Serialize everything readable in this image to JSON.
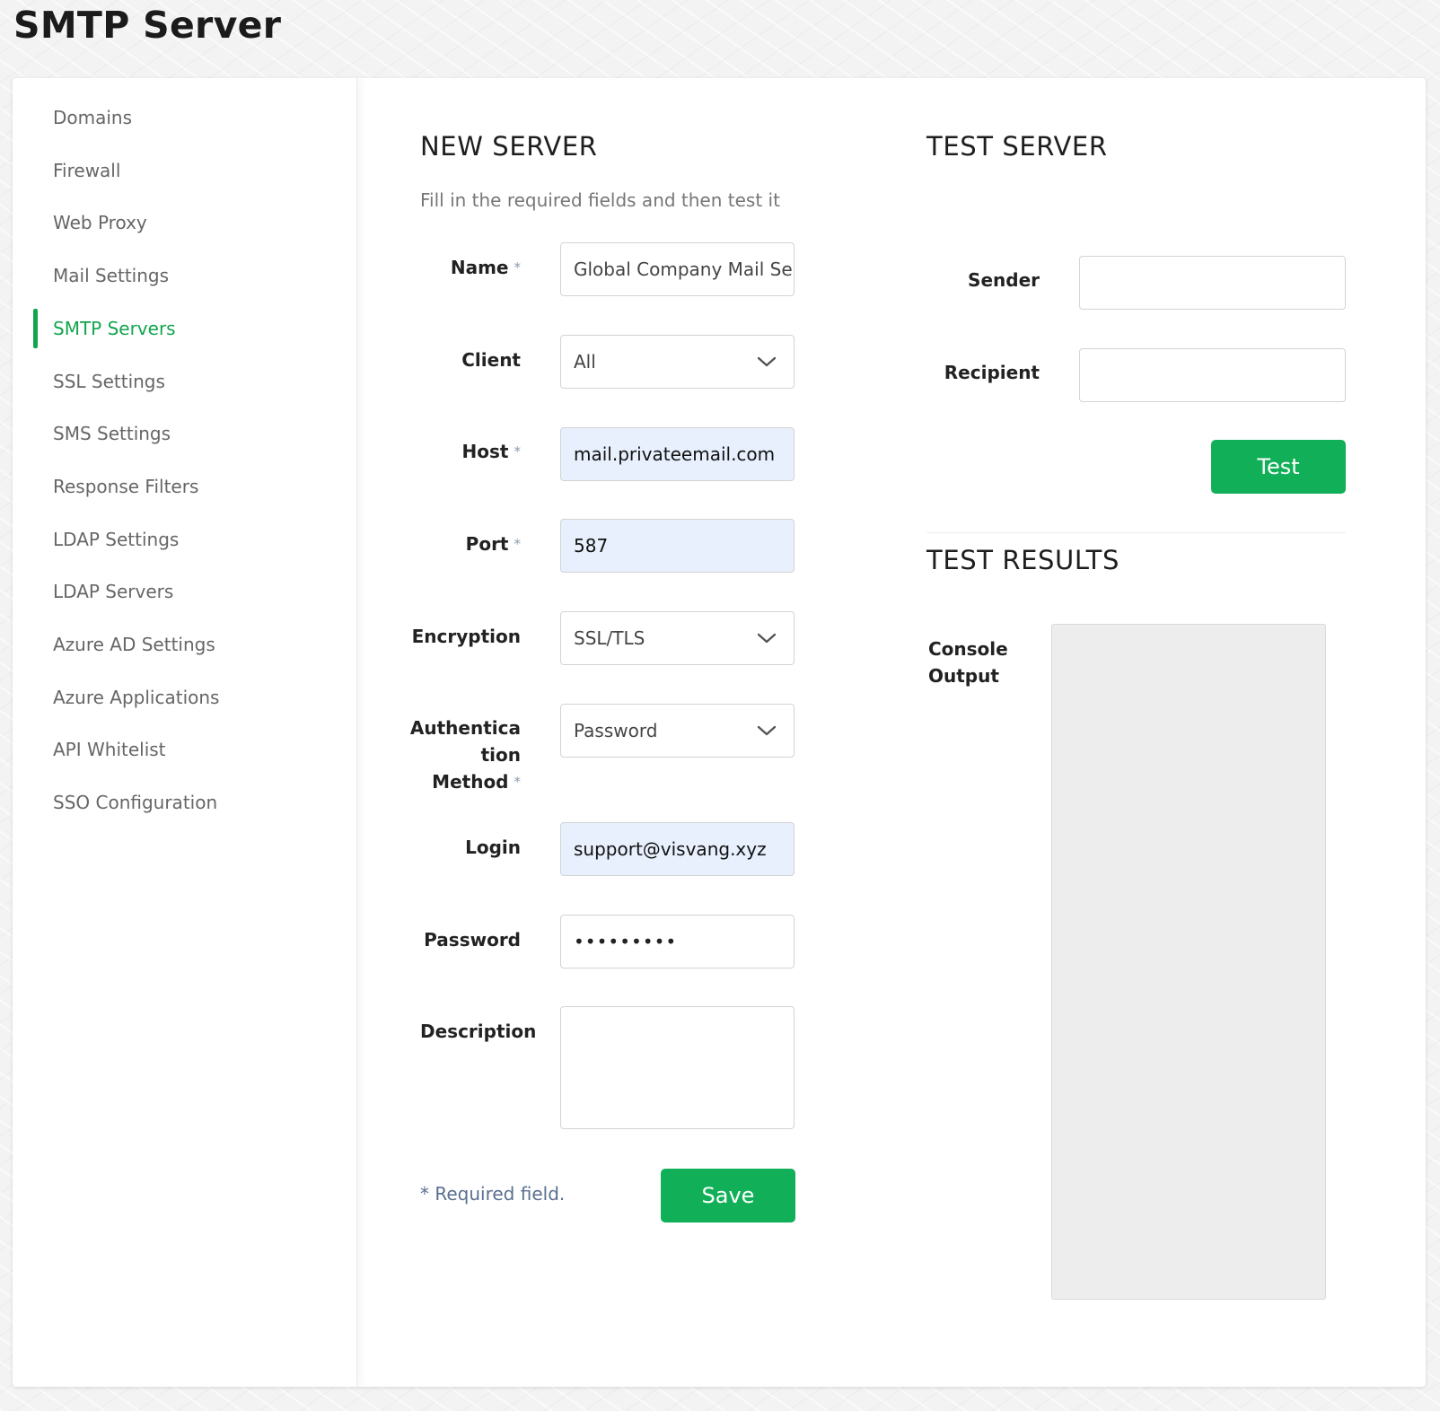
{
  "page": {
    "title": "SMTP Server"
  },
  "sidebar": {
    "items": [
      {
        "label": "Domains"
      },
      {
        "label": "Firewall"
      },
      {
        "label": "Web Proxy"
      },
      {
        "label": "Mail Settings"
      },
      {
        "label": "SMTP Servers",
        "active": true
      },
      {
        "label": "SSL Settings"
      },
      {
        "label": "SMS Settings"
      },
      {
        "label": "Response Filters"
      },
      {
        "label": "LDAP Settings"
      },
      {
        "label": "LDAP Servers"
      },
      {
        "label": "Azure AD Settings"
      },
      {
        "label": "Azure Applications"
      },
      {
        "label": "API Whitelist"
      },
      {
        "label": "SSO Configuration"
      }
    ]
  },
  "new_server": {
    "heading": "NEW SERVER",
    "subtitle": "Fill in the required fields and then test it",
    "required_mark": "*",
    "fields": {
      "name": {
        "label": "Name",
        "value": "Global Company Mail Ser"
      },
      "client": {
        "label": "Client",
        "value": "All"
      },
      "host": {
        "label": "Host",
        "value": "mail.privateemail.com"
      },
      "port": {
        "label": "Port",
        "value": "587"
      },
      "encryption": {
        "label": "Encryption",
        "value": "SSL/TLS"
      },
      "auth_method": {
        "label_line1": "Authentica",
        "label_line2": "tion",
        "label_line3": "Method",
        "value": "Password"
      },
      "login": {
        "label": "Login",
        "value": "support@visvang.xyz"
      },
      "password": {
        "label": "Password",
        "value": "•••••••••"
      },
      "description": {
        "label": "Description",
        "value": ""
      }
    },
    "required_note": "* Required field.",
    "save_label": "Save"
  },
  "test_server": {
    "heading": "TEST SERVER",
    "sender": {
      "label": "Sender",
      "value": ""
    },
    "recipient": {
      "label": "Recipient",
      "value": ""
    },
    "test_label": "Test"
  },
  "test_results": {
    "heading": "TEST RESULTS",
    "console_label_line1": "Console",
    "console_label_line2": "Output",
    "console_output": ""
  },
  "colors": {
    "accent": "#11b058",
    "autofill_bg": "#e8f0fe",
    "console_bg": "#ededed"
  }
}
